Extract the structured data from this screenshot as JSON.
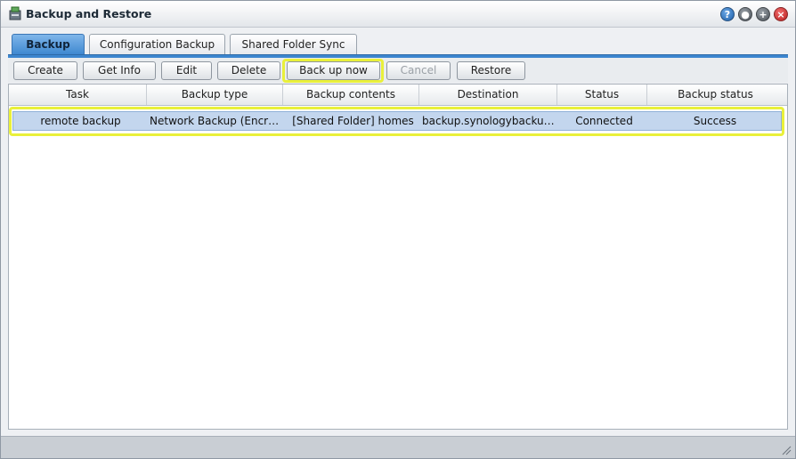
{
  "window": {
    "title": "Backup and Restore",
    "controls": {
      "help": "?",
      "minimize": "●",
      "maximize": "+",
      "close": "×"
    }
  },
  "tabs": [
    {
      "label": "Backup",
      "active": true
    },
    {
      "label": "Configuration Backup",
      "active": false
    },
    {
      "label": "Shared Folder Sync",
      "active": false
    }
  ],
  "toolbar": {
    "create": "Create",
    "get_info": "Get Info",
    "edit": "Edit",
    "delete": "Delete",
    "back_up_now": "Back up now",
    "cancel": "Cancel",
    "restore": "Restore"
  },
  "table": {
    "columns": [
      "Task",
      "Backup type",
      "Backup contents",
      "Destination",
      "Status",
      "Backup status"
    ],
    "rows": [
      [
        "remote backup",
        "Network Backup (Encry…",
        "[Shared Folder] homes",
        "backup.synologybackup…",
        "Connected",
        "Success"
      ]
    ]
  },
  "colors": {
    "accent": "#3c86cf",
    "highlight": "#e9f03a",
    "selected_row": "#c3d6ee"
  },
  "icons": {
    "app": "backup-app-icon",
    "help": "help-icon",
    "minimize": "minimize-icon",
    "maximize": "maximize-icon",
    "close": "close-icon",
    "resize": "resize-grip-icon"
  }
}
